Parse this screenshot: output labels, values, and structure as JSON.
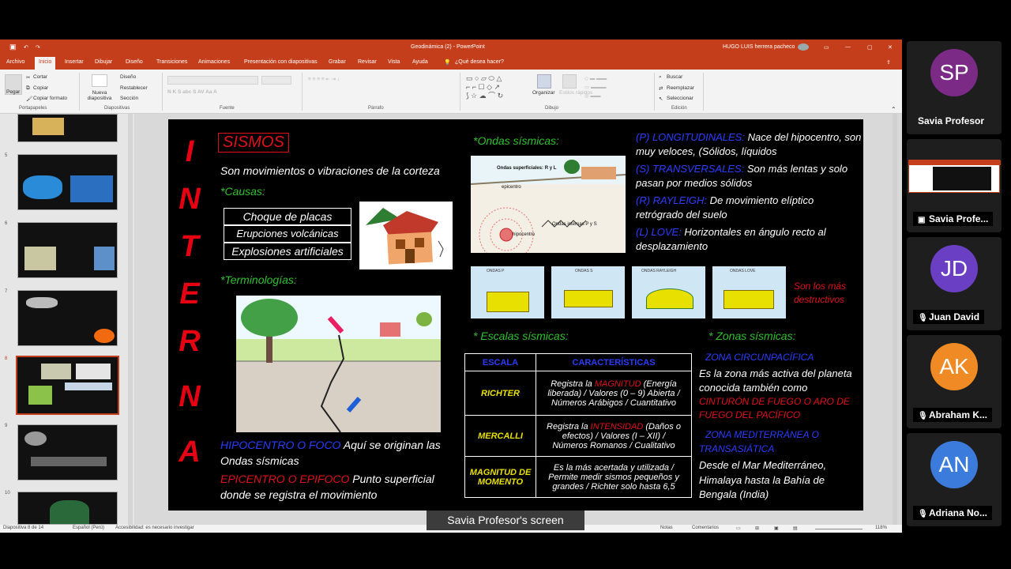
{
  "window": {
    "title": "Geodinámica (2) - PowerPoint",
    "user": "HUGO LUIS herrera pacheco",
    "tabs": [
      "Archivo",
      "Inicio",
      "Insertar",
      "Dibujar",
      "Diseño",
      "Transiciones",
      "Animaciones",
      "Presentación con diapositivas",
      "Grabar",
      "Revisar",
      "Vista",
      "Ayuda",
      "¿Qué desea hacer?"
    ]
  },
  "ribbon": {
    "paste": "Pegar",
    "cut": "Cortar",
    "copy": "Copiar",
    "format_painter": "Copiar formato",
    "new_slide": "Nueva diapositiva",
    "layout": "Diseño",
    "reset": "Restablecer",
    "section": "Sección",
    "arrange": "Organizar",
    "quick_styles": "Estilos rápidos",
    "find": "Buscar",
    "replace": "Reemplazar",
    "select": "Seleccionar",
    "groups": [
      "Portapapeles",
      "Diapositivas",
      "Fuente",
      "Párrafo",
      "Dibujo",
      "Edición"
    ]
  },
  "thumbnails": [
    "5",
    "6",
    "7",
    "8",
    "9",
    "10"
  ],
  "status": {
    "slide": "Diapositiva 8 de 14",
    "lang": "Español (Perú)",
    "accessibility": "Accesibilidad: es necesario investigar",
    "notes": "Notas",
    "comments": "Comentarios",
    "zoom": "118%"
  },
  "slide": {
    "vertical_letters": [
      "I",
      "N",
      "T",
      "E",
      "R",
      "N",
      "A"
    ],
    "title": "SISMOS",
    "definition": "Son movimientos o vibraciones de la corteza",
    "causes_heading": "*Causas:",
    "causes": [
      "Choque de placas",
      "Erupciones volcánicas",
      "Explosiones artificiales"
    ],
    "terms_heading": "*Terminologías:",
    "hypocenter_label": "HIPOCENTRO O FOCO",
    "hypocenter_text": " Aquí se originan las",
    "hypocenter_text2": "Ondas sísmicas",
    "epicenter_label": "EPICENTRO O EPIFOCO",
    "epicenter_text": " Punto superficial",
    "epicenter_text2": "donde se registra el movimiento",
    "waves_heading": "*Ondas sísmicas:",
    "wave_diagram": {
      "surface": "Ondas superficiales: R y L",
      "epicenter": "epicentro",
      "hypocenter": "hipocentro",
      "internal": "Ondas   internas   P y S"
    },
    "waves": [
      {
        "label": "(P) LONGITUDINALES:",
        "text": " Nace del hipocentro, son",
        "text2": "muy veloces, (Sólidos, líquidos"
      },
      {
        "label": "(S) TRANSVERSALES:",
        "text": " Son más lentas y solo",
        "text2": "pasan por medios sólidos"
      },
      {
        "label": "(R) RAYLEIGH:",
        "text": " De movimiento elíptico",
        "text2": "retrógrado del suelo"
      },
      {
        "label": "(L) LOVE:",
        "text": " Horizontales en ángulo recto al",
        "text2": "desplazamiento"
      }
    ],
    "wave_boxes": [
      "ONDAS P",
      "ONDAS S",
      "ONDAS RAYLEIGH",
      "ONDAS LOVE"
    ],
    "destructive_1": "Son los más",
    "destructive_2": "destructivos",
    "scales_heading": "* Escalas sísmicas:",
    "scales_table": {
      "headers": [
        "ESCALA",
        "CARACTERÍSTICAS"
      ],
      "rows": [
        {
          "name": "RICHTER",
          "pre": "Registra la ",
          "hl": "MAGNITUD",
          "post": " (Energía",
          "l2": "liberada) / Valores (0 – 9) Abierta /",
          "l3": "Números Arábigos / Cuantitativo"
        },
        {
          "name": "MERCALLI",
          "pre": "Registra la ",
          "hl": "INTENSIDAD",
          "post": " (Daños o",
          "l2": "efectos) / Valores (I – XII) /",
          "l3": "Números Romanos / Cualitativo"
        },
        {
          "name": "MAGNITUD DE MOMENTO",
          "pre": "",
          "hl": "",
          "post": "Es la más acertada y utilizada /",
          "l2": "Permite medir sismos pequeños y",
          "l3": "grandes / Richter solo hasta 6,5"
        }
      ]
    },
    "zones_heading": "* Zonas sísmicas:",
    "zone1_title": "ZONA CIRCUNPACÍFICA",
    "zone1_l1": "Es la zona más activa del planeta",
    "zone1_l2": "conocida también como",
    "zone1_red1": "CINTURÓN DE FUEGO O ARO DE",
    "zone1_red2": "FUEGO DEL PACÍFICO",
    "zone2_title1": "ZONA MEDITERRÁNEA O",
    "zone2_title2": "TRANSASIÁTICA",
    "zone2_l1": "Desde el Mar Mediterráneo,",
    "zone2_l2": "Himalaya hasta la Bahía de",
    "zone2_l3": "Bengala (India)"
  },
  "participants": [
    {
      "initials": "SP",
      "name": "Savia Profesor",
      "color": "#7b2b86",
      "muted": false
    },
    {
      "initials": "",
      "name": "Savia Profe...",
      "color": "#333333",
      "muted": false
    },
    {
      "initials": "JD",
      "name": "Juan David",
      "color": "#6a3fc4",
      "muted": true
    },
    {
      "initials": "AK",
      "name": "Abraham K...",
      "color": "#f08a24",
      "muted": true
    },
    {
      "initials": "AN",
      "name": "Adriana No...",
      "color": "#3a7bdc",
      "muted": true
    }
  ],
  "share_banner": "Savia Profesor's screen"
}
